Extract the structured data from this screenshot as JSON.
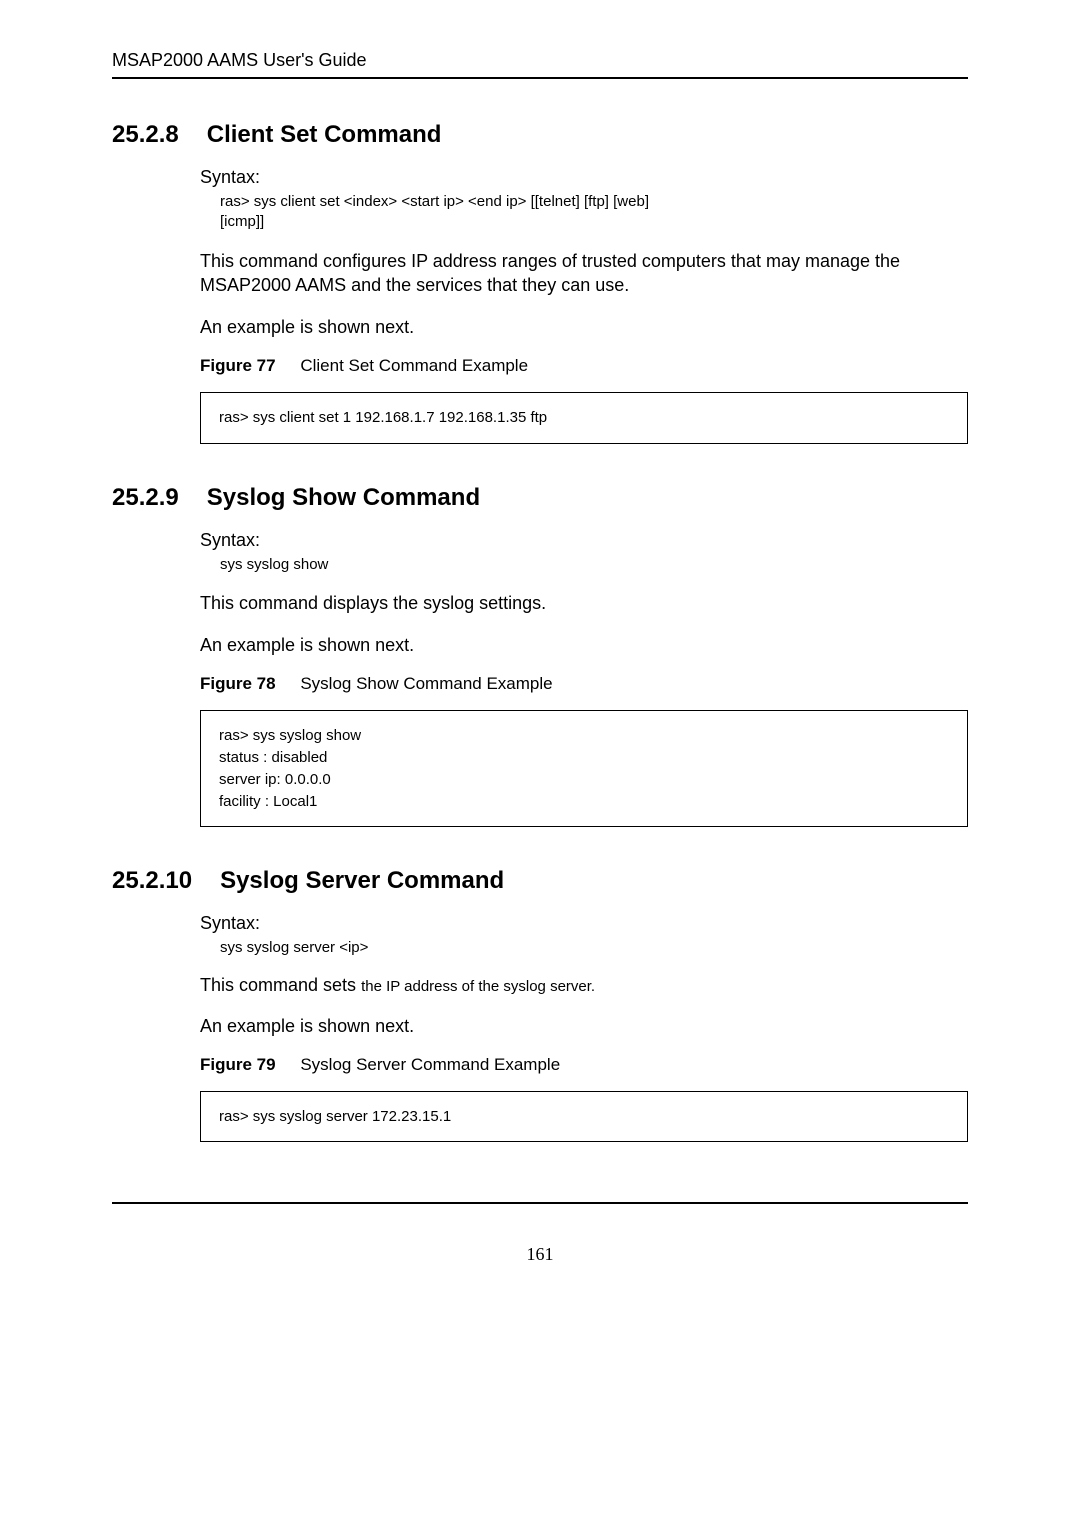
{
  "header": {
    "running_head": "MSAP2000 AAMS User's Guide"
  },
  "sections": [
    {
      "num": "25.2.8",
      "title": "Client Set Command",
      "syntax_label": "Syntax:",
      "syntax": "ras> sys client set <index> <start ip> <end ip> [[telnet] [ftp] [web]\n[icmp]]",
      "desc": "This command configures IP address ranges of trusted computers that may manage the MSAP2000 AAMS\nand the services that they can use.",
      "example_note": "An example is shown next.",
      "figure_label": "Figure 77",
      "figure_caption": "Client Set Command Example",
      "code": "ras> sys client set 1 192.168.1.7 192.168.1.35 ftp"
    },
    {
      "num": "25.2.9",
      "title": "Syslog Show Command",
      "syntax_label": "Syntax:",
      "syntax": "sys syslog show",
      "desc": "This command displays the syslog settings.",
      "example_note": "An example is shown next.",
      "figure_label": "Figure 78",
      "figure_caption": "Syslog Show Command Example",
      "code": "ras> sys syslog show\nstatus     : disabled\nserver ip: 0.0.0.0\nfacility : Local1"
    },
    {
      "num": "25.2.10",
      "title": "Syslog Server Command",
      "syntax_label": "Syntax:",
      "syntax": "sys syslog server <ip>",
      "desc_lead": "This command sets ",
      "desc_tail": "the IP address of the syslog server.",
      "example_note": "An example is shown next.",
      "figure_label": "Figure 79",
      "figure_caption": "Syslog Server Command Example",
      "code": "ras> sys syslog server 172.23.15.1"
    }
  ],
  "footer": {
    "page_number": "161"
  }
}
